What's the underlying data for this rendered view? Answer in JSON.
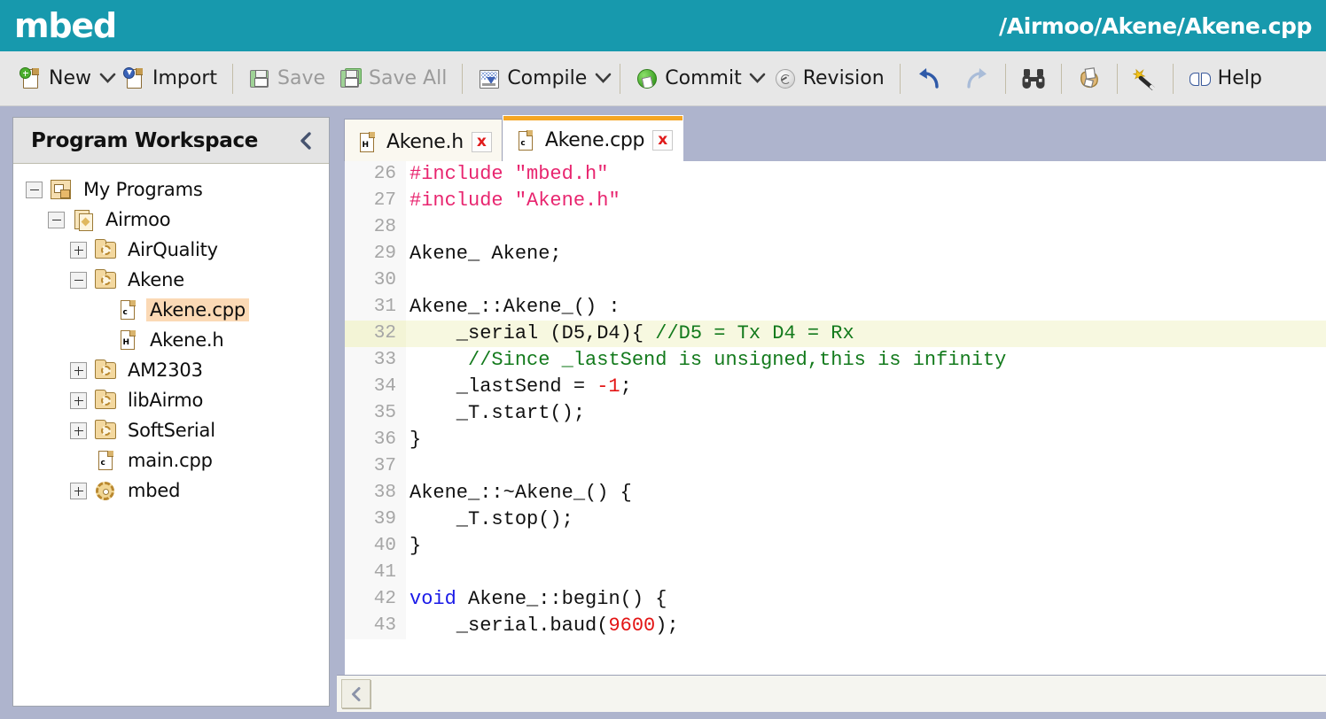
{
  "brand": {
    "logo": "mbed",
    "path": "/Airmoo/Akene/Akene.cpp",
    "accent_teal": "#1799ad"
  },
  "toolbar": {
    "items": [
      {
        "label": "New",
        "icon": "new-file-icon",
        "caret": true,
        "disabled": false
      },
      {
        "label": "Import",
        "icon": "import-icon",
        "caret": false,
        "disabled": false
      },
      {
        "label": "Save",
        "icon": "save-icon",
        "caret": false,
        "disabled": true
      },
      {
        "label": "Save All",
        "icon": "save-all-icon",
        "caret": false,
        "disabled": true
      },
      {
        "label": "Compile",
        "icon": "compile-icon",
        "caret": true,
        "disabled": false
      },
      {
        "label": "Commit",
        "icon": "commit-icon",
        "caret": true,
        "disabled": false
      },
      {
        "label": "Revision",
        "icon": "revision-icon",
        "caret": false,
        "disabled": false
      },
      {
        "label": "",
        "icon": "undo-icon",
        "caret": false,
        "disabled": false
      },
      {
        "label": "",
        "icon": "redo-icon",
        "caret": false,
        "disabled": true
      },
      {
        "label": "",
        "icon": "binoculars-icon",
        "caret": false,
        "disabled": false
      },
      {
        "label": "",
        "icon": "export-bag-icon",
        "caret": false,
        "disabled": false
      },
      {
        "label": "",
        "icon": "magic-wand-icon",
        "caret": false,
        "disabled": false
      },
      {
        "label": "Help",
        "icon": "help-book-icon",
        "caret": false,
        "disabled": false
      }
    ]
  },
  "sidebar": {
    "title": "Program Workspace",
    "collapse_icon": "chevron-left-icon",
    "tree": [
      {
        "label": "My Programs",
        "indent": 0,
        "toggle": "minus",
        "icon": "programs-icon",
        "ext": "",
        "selected": false
      },
      {
        "label": "Airmoo",
        "indent": 1,
        "toggle": "minus",
        "icon": "program-icon",
        "ext": "",
        "selected": false
      },
      {
        "label": "AirQuality",
        "indent": 2,
        "toggle": "plus",
        "icon": "library-icon",
        "ext": "",
        "selected": false
      },
      {
        "label": "Akene",
        "indent": 2,
        "toggle": "minus",
        "icon": "library-icon",
        "ext": "",
        "selected": false
      },
      {
        "label": "Akene.cpp",
        "indent": 3,
        "toggle": "none",
        "icon": "cpp-file-icon",
        "ext": "c",
        "selected": true
      },
      {
        "label": "Akene.h",
        "indent": 3,
        "toggle": "none",
        "icon": "header-file-icon",
        "ext": "H",
        "selected": false
      },
      {
        "label": "AM2303",
        "indent": 2,
        "toggle": "plus",
        "icon": "library-icon",
        "ext": "",
        "selected": false
      },
      {
        "label": "libAirmo",
        "indent": 2,
        "toggle": "plus",
        "icon": "library-icon",
        "ext": "",
        "selected": false
      },
      {
        "label": "SoftSerial",
        "indent": 2,
        "toggle": "plus",
        "icon": "library-icon",
        "ext": "",
        "selected": false
      },
      {
        "label": "main.cpp",
        "indent": 2,
        "toggle": "none",
        "icon": "cpp-file-icon",
        "ext": "c",
        "selected": false
      },
      {
        "label": "mbed",
        "indent": 2,
        "toggle": "plus",
        "icon": "gear-icon",
        "ext": "",
        "selected": false
      }
    ]
  },
  "editor": {
    "tabs": [
      {
        "label": "Akene.h",
        "ext": "H",
        "active": false,
        "close": "x"
      },
      {
        "label": "Akene.cpp",
        "ext": "c",
        "active": true,
        "close": "x"
      }
    ],
    "active_tab_accent": "#f5a623",
    "highlight_line": 32,
    "highlight_color": "#f7f8e0",
    "first_line": 26,
    "last_line": 43,
    "lines": [
      {
        "n": "26",
        "tokens": [
          {
            "t": "#include ",
            "c": "t-pre"
          },
          {
            "t": "\"mbed.h\"",
            "c": "t-str"
          }
        ]
      },
      {
        "n": "27",
        "tokens": [
          {
            "t": "#include ",
            "c": "t-pre"
          },
          {
            "t": "\"Akene.h\"",
            "c": "t-str"
          }
        ]
      },
      {
        "n": "28",
        "tokens": []
      },
      {
        "n": "29",
        "tokens": [
          {
            "t": "Akene_ Akene;",
            "c": ""
          }
        ]
      },
      {
        "n": "30",
        "tokens": []
      },
      {
        "n": "31",
        "tokens": [
          {
            "t": "Akene_::Akene_() :",
            "c": ""
          }
        ]
      },
      {
        "n": "32",
        "tokens": [
          {
            "t": "    _serial (D5,D4){ ",
            "c": ""
          },
          {
            "t": "//D5 = Tx D4 = Rx",
            "c": "t-cmt"
          }
        ]
      },
      {
        "n": "33",
        "tokens": [
          {
            "t": "     ",
            "c": ""
          },
          {
            "t": "//Since _lastSend is unsigned,this is infinity",
            "c": "t-cmt"
          }
        ]
      },
      {
        "n": "34",
        "tokens": [
          {
            "t": "    _lastSend = ",
            "c": ""
          },
          {
            "t": "-1",
            "c": "t-num"
          },
          {
            "t": ";",
            "c": ""
          }
        ]
      },
      {
        "n": "35",
        "tokens": [
          {
            "t": "    _T.start();",
            "c": ""
          }
        ]
      },
      {
        "n": "36",
        "tokens": [
          {
            "t": "}",
            "c": ""
          }
        ]
      },
      {
        "n": "37",
        "tokens": []
      },
      {
        "n": "38",
        "tokens": [
          {
            "t": "Akene_::~Akene_() {",
            "c": ""
          }
        ]
      },
      {
        "n": "39",
        "tokens": [
          {
            "t": "    _T.stop();",
            "c": ""
          }
        ]
      },
      {
        "n": "40",
        "tokens": [
          {
            "t": "}",
            "c": ""
          }
        ]
      },
      {
        "n": "41",
        "tokens": []
      },
      {
        "n": "42",
        "tokens": [
          {
            "t": "void",
            "c": "t-kw"
          },
          {
            "t": " Akene_::begin() {",
            "c": ""
          }
        ]
      },
      {
        "n": "43",
        "tokens": [
          {
            "t": "    _serial.baud(",
            "c": ""
          },
          {
            "t": "9600",
            "c": "t-num"
          },
          {
            "t": ");",
            "c": ""
          }
        ]
      }
    ],
    "status_collapse_icon": "chevron-left-icon"
  },
  "colors": {
    "preprocessor": "#e8256f",
    "string": "#e8256f",
    "comment": "#137a1c",
    "number": "#e31414",
    "keyword": "#1a1ae8",
    "tabstrip_bg": "#aeb4cd",
    "selected_file_bg": "#fbd9b5"
  }
}
